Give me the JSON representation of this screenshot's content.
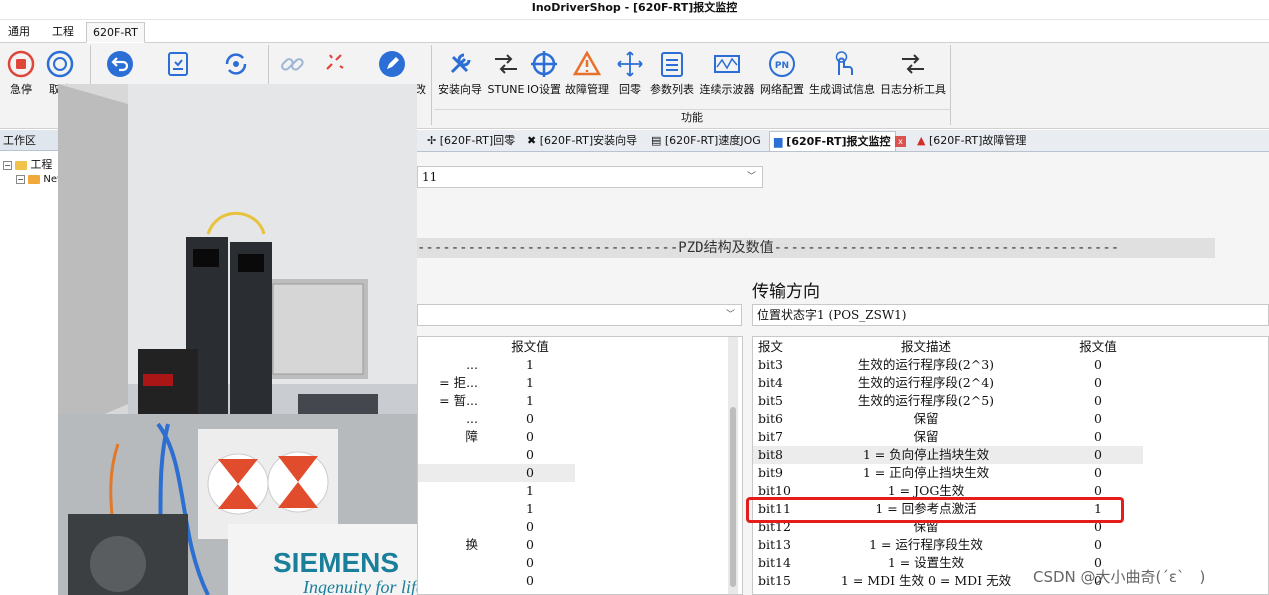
{
  "window": {
    "title": "InoDriverShop - [620F-RT]报文监控"
  },
  "menubar": {
    "tabs": [
      "通用",
      "工程",
      "620F-RT"
    ]
  },
  "ribbon": {
    "control_buttons": [
      {
        "label": "急停",
        "icon": "stop-icon"
      },
      {
        "label": "取消",
        "icon": "cancel-icon"
      },
      {
        "label": "",
        "icon": "undo-icon"
      },
      {
        "label": "",
        "icon": "save-params-icon"
      },
      {
        "label": "",
        "icon": "sync-icon"
      },
      {
        "label": "",
        "icon": "connect-icon"
      },
      {
        "label": "",
        "icon": "disconnect-icon"
      },
      {
        "label": "改",
        "icon": "edit-icon"
      }
    ],
    "function_buttons": [
      {
        "label": "安装向导",
        "icon": "wrench-icon"
      },
      {
        "label": "STUNE",
        "icon": "stune-icon"
      },
      {
        "label": "IO设置",
        "icon": "crosshair-icon"
      },
      {
        "label": "故障管理",
        "icon": "warning-icon"
      },
      {
        "label": "回零",
        "icon": "home-icon"
      },
      {
        "label": "参数列表",
        "icon": "list-icon"
      },
      {
        "label": "连续示波器",
        "icon": "scope-icon"
      },
      {
        "label": "网络配置",
        "icon": "pn-icon"
      },
      {
        "label": "生成调试信息",
        "icon": "touch-icon"
      },
      {
        "label": "日志分析工具",
        "icon": "log-icon"
      }
    ],
    "group_label": "功能"
  },
  "workspace": {
    "header": "工作区",
    "tree": [
      {
        "label": "工程",
        "icon": "folder-icon"
      },
      {
        "label": "New",
        "icon": "folder-open-icon"
      }
    ]
  },
  "doc_tabs": [
    {
      "label": "[620F-RT]回零",
      "icon": "home-icon"
    },
    {
      "label": "[620F-RT]安装向导",
      "icon": "wrench-icon"
    },
    {
      "label": "[620F-RT]速度JOG",
      "icon": "jog-icon"
    },
    {
      "label": "[620F-RT]报文监控",
      "icon": "monitor-icon",
      "active": true
    },
    {
      "label": "[620F-RT]故障管理",
      "icon": "warning-icon"
    }
  ],
  "monitor": {
    "telegram_select": "11",
    "pzd_heading": "PZD结构及数值",
    "direction_label": "传输方向",
    "left_select": "",
    "right_select": "位置状态字1 (POS_ZSW1)",
    "left_table": {
      "value_header": "报文值",
      "rows": [
        {
          "desc": "...",
          "value": "1"
        },
        {
          "desc": "= 拒...",
          "value": "1"
        },
        {
          "desc": "= 暂...",
          "value": "1"
        },
        {
          "desc": "...",
          "value": "0"
        },
        {
          "desc": "障",
          "value": "0"
        },
        {
          "desc": "",
          "value": "0"
        },
        {
          "desc": "",
          "value": "0"
        },
        {
          "desc": "",
          "value": "1"
        },
        {
          "desc": "",
          "value": "1"
        },
        {
          "desc": "",
          "value": "0"
        },
        {
          "desc": "换",
          "value": "0"
        },
        {
          "desc": "",
          "value": "0"
        },
        {
          "desc": "",
          "value": "0"
        }
      ]
    },
    "right_table": {
      "headers": [
        "报文",
        "报文描述",
        "报文值"
      ],
      "rows": [
        {
          "bit": "bit3",
          "desc": "生效的运行程序段(2^3)",
          "value": "0"
        },
        {
          "bit": "bit4",
          "desc": "生效的运行程序段(2^4)",
          "value": "0"
        },
        {
          "bit": "bit5",
          "desc": "生效的运行程序段(2^5)",
          "value": "0"
        },
        {
          "bit": "bit6",
          "desc": "保留",
          "value": "0"
        },
        {
          "bit": "bit7",
          "desc": "保留",
          "value": "0"
        },
        {
          "bit": "bit8",
          "desc": "1 = 负向停止挡块生效",
          "value": "0"
        },
        {
          "bit": "bit9",
          "desc": "1 = 正向停止挡块生效",
          "value": "0"
        },
        {
          "bit": "bit10",
          "desc": "1 = JOG生效",
          "value": "0"
        },
        {
          "bit": "bit11",
          "desc": "1 = 回参考点激活",
          "value": "1"
        },
        {
          "bit": "bit12",
          "desc": "保留",
          "value": "0"
        },
        {
          "bit": "bit13",
          "desc": "1 = 运行程序段生效",
          "value": "0"
        },
        {
          "bit": "bit14",
          "desc": "1 = 设置生效",
          "value": "0"
        },
        {
          "bit": "bit15",
          "desc": "1 = MDI 生效  0 = MDI 无效",
          "value": "0"
        }
      ]
    }
  },
  "photo": {
    "brand": "SIEMENS",
    "tagline": "Ingenuity for life"
  },
  "watermark": "CSDN @大小曲奇(´ε`　)"
}
